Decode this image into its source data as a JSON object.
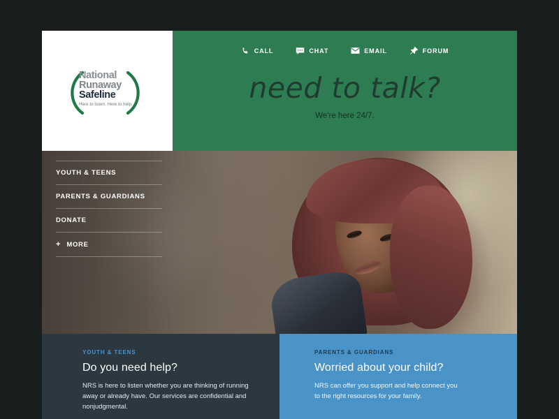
{
  "colors": {
    "page_background": "#1a1d1e",
    "green_header": "#2e7d52",
    "navy_card": "#2b3840",
    "blue_card": "#4a93c9",
    "logo_navy": "#1d2c3a",
    "logo_gray": "#8a8f94",
    "logo_green": "#1f7a45"
  },
  "logo": {
    "line1": "National",
    "line2": "Runaway",
    "line3": "Safeline",
    "tagline": "Here to listen. Here to help."
  },
  "utility_nav": [
    {
      "label": "CALL",
      "icon": "phone-icon"
    },
    {
      "label": "CHAT",
      "icon": "chat-bubble-icon"
    },
    {
      "label": "EMAIL",
      "icon": "envelope-icon"
    },
    {
      "label": "FORUM",
      "icon": "pushpin-icon"
    }
  ],
  "hero": {
    "headline": "need to talk?",
    "subhead": "We're here 24/7."
  },
  "sidebar": {
    "items": [
      {
        "label": "YOUTH & TEENS",
        "has_plus": false
      },
      {
        "label": "PARENTS & GUARDIANS",
        "has_plus": false
      },
      {
        "label": "DONATE",
        "has_plus": false
      },
      {
        "label": "MORE",
        "has_plus": true,
        "plus": "+"
      }
    ]
  },
  "cards": {
    "left": {
      "eyebrow": "YOUTH & TEENS",
      "title": "Do you need help?",
      "body": "NRS is here to listen whether you are thinking of running away or already have. Our services are confidential and nonjudgmental."
    },
    "right": {
      "eyebrow": "PARENTS & GUARDIANS",
      "title": "Worried about your child?",
      "body": "NRS can offer you support and help connect you to the right resources for your family."
    }
  }
}
